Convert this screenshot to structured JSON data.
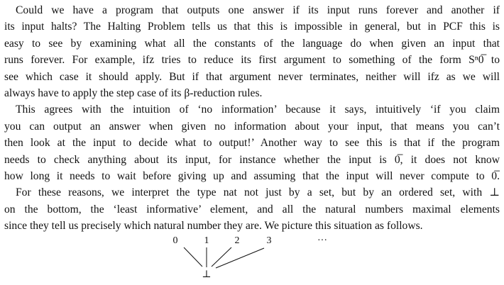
{
  "paragraphs": [
    {
      "lines": [
        "Could we have a program that outputs one answer if its input runs forever and another if",
        "its input halts? The Halting Problem tells us that this is impossible in general, but in PCF this is",
        "easy to see by examining what all the constants of the language do when given an input that",
        "runs forever. For example, ifz tries to reduce its first argument to something of the form Sⁿ0̅ to",
        "see which case it should apply. But if that argument never terminates, neither will ifz as we will",
        "always have to apply the step case of its β-reduction rules."
      ]
    },
    {
      "lines": [
        "This agrees with the intuition of ‘no information’ because it says, intuitively ‘if you claim",
        "you can output an answer when given no information about your input, that means you can’t",
        "then look at the input to decide what to output!’ Another way to see this is that if the program",
        "needs to check anything about its input, for instance whether the input is 0̅, it does not know",
        "how long it needs to wait before giving up and assuming that the input will never compute to 0̅."
      ]
    },
    {
      "lines": [
        "For these reasons, we interpret the type nat not just by a set, but by an ordered set, with ⊥",
        "on the bottom, the ‘least informative’ element, and all the natural numbers maximal elements",
        "since they tell us precisely which natural number they are. We picture this situation as follows."
      ]
    }
  ],
  "diagram": {
    "top_nodes": [
      "0",
      "1",
      "2",
      "3",
      "···"
    ],
    "bottom_node": "⊥"
  }
}
